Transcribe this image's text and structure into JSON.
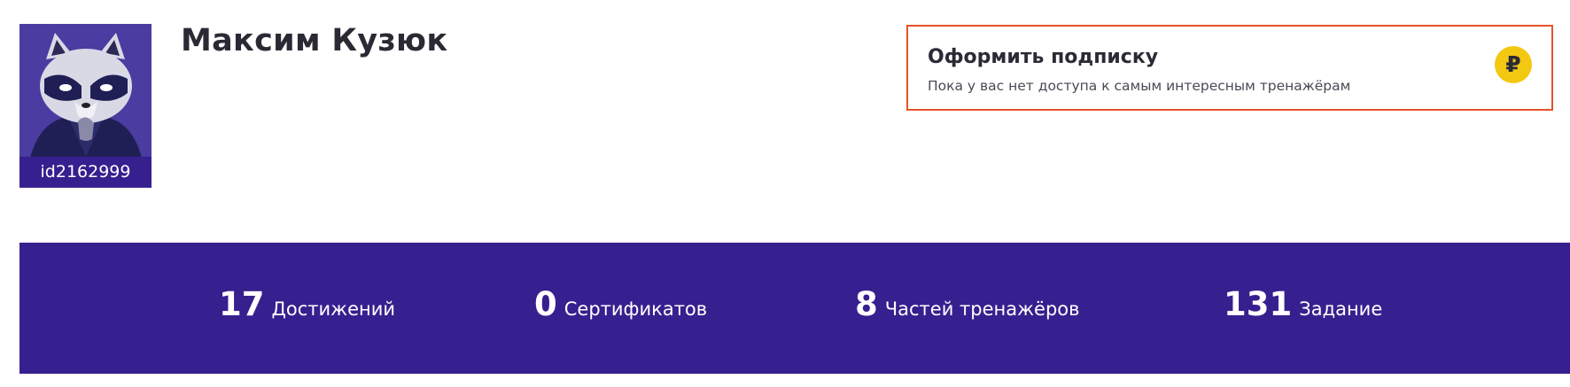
{
  "profile": {
    "name": "Максим Кузюк",
    "id": "id2162999",
    "avatar_icon": "raccoon-avatar"
  },
  "subscription": {
    "title": "Оформить подписку",
    "description": "Пока у вас нет доступа к самым интересным тренажёрам",
    "icon": "ruble-coin-icon",
    "icon_glyph": "₽",
    "border_color": "#e4532a",
    "icon_color": "#f2c811"
  },
  "stats": [
    {
      "value": "17",
      "label": "Достижений"
    },
    {
      "value": "0",
      "label": "Сертификатов"
    },
    {
      "value": "8",
      "label": "Частей тренажёров"
    },
    {
      "value": "131",
      "label": "Задание"
    }
  ],
  "colors": {
    "panel": "#36208f"
  }
}
